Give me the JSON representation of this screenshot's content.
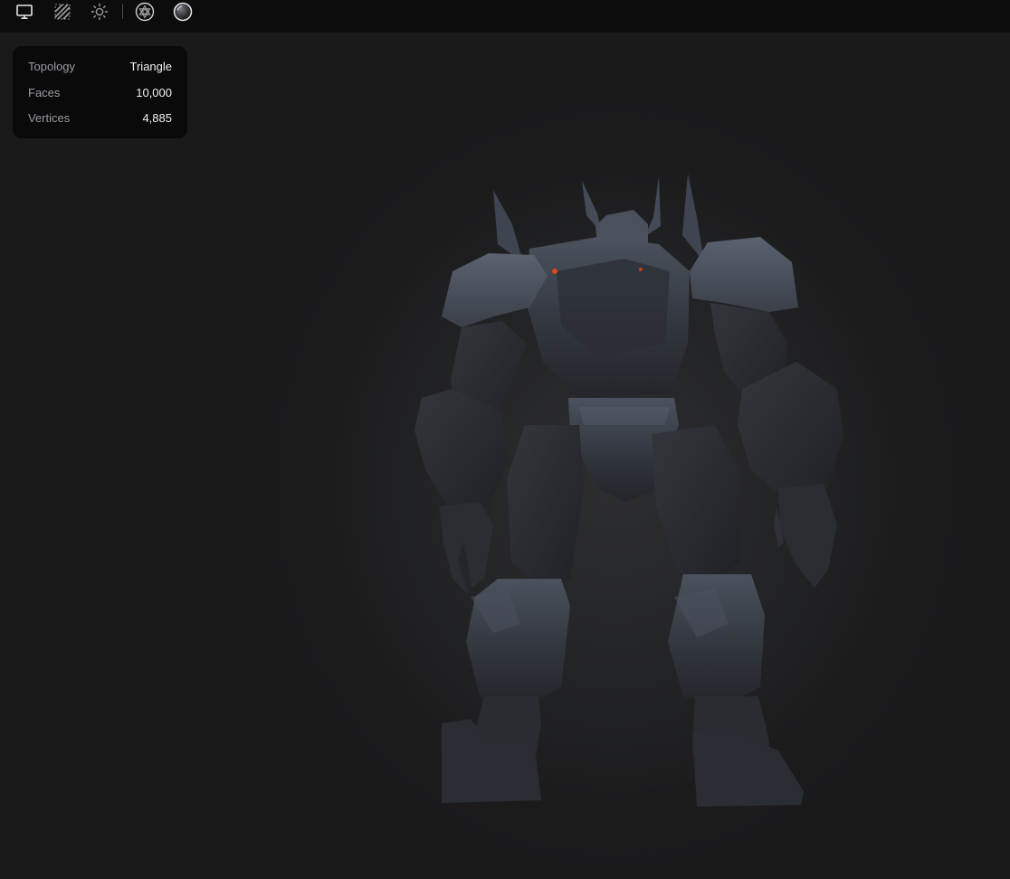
{
  "toolbar": {
    "buttons": [
      {
        "name": "monitor-icon",
        "label": "Display"
      },
      {
        "name": "wireframe-icon",
        "label": "Wireframe"
      },
      {
        "name": "sun-icon",
        "label": "Lighting"
      },
      {
        "name": "matcap-icon",
        "label": "Material"
      },
      {
        "name": "sphere-icon",
        "label": "Environment"
      }
    ]
  },
  "info": {
    "topology_label": "Topology",
    "topology_value": "Triangle",
    "faces_label": "Faces",
    "faces_value": "10,000",
    "vertices_label": "Vertices",
    "vertices_value": "4,885"
  },
  "colors": {
    "toolbar_bg": "#0c0c0d",
    "panel_bg": "#0a0a0b",
    "viewport_bg": "#1a1a1b",
    "model_base": "#2a2c31",
    "model_highlight": "#4a5260",
    "accent_glow": "#d8481e"
  }
}
